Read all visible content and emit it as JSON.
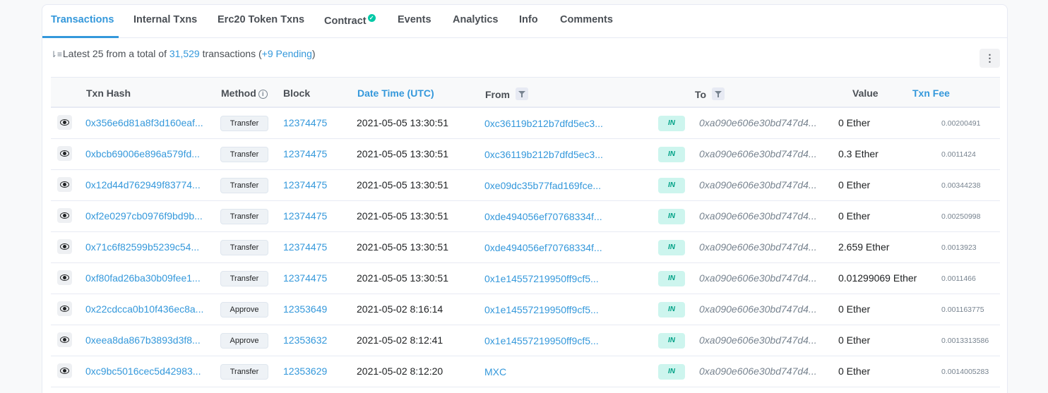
{
  "tabs": [
    {
      "label": "Transactions",
      "active": true
    },
    {
      "label": "Internal Txns"
    },
    {
      "label": "Erc20 Token Txns"
    },
    {
      "label": "Contract"
    },
    {
      "label": "Events"
    },
    {
      "label": "Analytics"
    },
    {
      "label": "Info"
    },
    {
      "label": "Comments"
    }
  ],
  "summary": {
    "prefix": "Latest 25 from a total of",
    "total": "31,529",
    "middle": "transactions (",
    "pending": "+9 Pending",
    "suffix": ")"
  },
  "more_button": "⋮",
  "columns": {
    "txn_hash": "Txn Hash",
    "method": "Method",
    "block": "Block",
    "datetime": "Date Time (UTC)",
    "from": "From",
    "to": "To",
    "value": "Value",
    "txn_fee": "Txn Fee"
  },
  "rows": [
    {
      "hash": "0x356e6d81a8f3d160eaf...",
      "method": "Transfer",
      "block": "12374475",
      "time": "2021-05-05 13:30:51",
      "from": "0xc36119b212b7dfd5ec3...",
      "dir": "IN",
      "to": "0xa090e606e30bd747d4...",
      "value": "0 Ether",
      "fee": "0.00200491"
    },
    {
      "hash": "0xbcb69006e896a579fd...",
      "method": "Transfer",
      "block": "12374475",
      "time": "2021-05-05 13:30:51",
      "from": "0xc36119b212b7dfd5ec3...",
      "dir": "IN",
      "to": "0xa090e606e30bd747d4...",
      "value": "0.3 Ether",
      "fee": "0.0011424"
    },
    {
      "hash": "0x12d44d762949f83774...",
      "method": "Transfer",
      "block": "12374475",
      "time": "2021-05-05 13:30:51",
      "from": "0xe09dc35b77fad169fce...",
      "dir": "IN",
      "to": "0xa090e606e30bd747d4...",
      "value": "0 Ether",
      "fee": "0.00344238"
    },
    {
      "hash": "0xf2e0297cb0976f9bd9b...",
      "method": "Transfer",
      "block": "12374475",
      "time": "2021-05-05 13:30:51",
      "from": "0xde494056ef70768334f...",
      "dir": "IN",
      "to": "0xa090e606e30bd747d4...",
      "value": "0 Ether",
      "fee": "0.00250998"
    },
    {
      "hash": "0x71c6f82599b5239c54...",
      "method": "Transfer",
      "block": "12374475",
      "time": "2021-05-05 13:30:51",
      "from": "0xde494056ef70768334f...",
      "dir": "IN",
      "to": "0xa090e606e30bd747d4...",
      "value": "2.659 Ether",
      "fee": "0.0013923"
    },
    {
      "hash": "0xf80fad26ba30b09fee1...",
      "method": "Transfer",
      "block": "12374475",
      "time": "2021-05-05 13:30:51",
      "from": "0x1e14557219950ff9cf5...",
      "dir": "IN",
      "to": "0xa090e606e30bd747d4...",
      "value": "0.01299069 Ether",
      "fee": "0.0011466"
    },
    {
      "hash": "0x22cdcca0b10f436ec8a...",
      "method": "Approve",
      "block": "12353649",
      "time": "2021-05-02 8:16:14",
      "from": "0x1e14557219950ff9cf5...",
      "dir": "IN",
      "to": "0xa090e606e30bd747d4...",
      "value": "0 Ether",
      "fee": "0.001163775"
    },
    {
      "hash": "0xeea8da867b3893d3f8...",
      "method": "Approve",
      "block": "12353632",
      "time": "2021-05-02 8:12:41",
      "from": "0x1e14557219950ff9cf5...",
      "dir": "IN",
      "to": "0xa090e606e30bd747d4...",
      "value": "0 Ether",
      "fee": "0.0013313586"
    },
    {
      "hash": "0xc9bc5016cec5d42983...",
      "method": "Transfer",
      "block": "12353629",
      "time": "2021-05-02 8:12:20",
      "from": "MXC",
      "dir": "IN",
      "to": "0xa090e606e30bd747d4...",
      "value": "0 Ether",
      "fee": "0.0014005283"
    }
  ]
}
